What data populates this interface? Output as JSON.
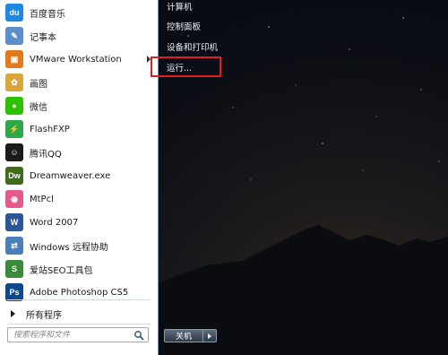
{
  "programs": [
    {
      "label": "百度音乐",
      "icon": "baidu-music-icon",
      "color": "#1e88e5",
      "glyph": "du"
    },
    {
      "label": "记事本",
      "icon": "notepad-icon",
      "color": "#5b8fc7",
      "glyph": "✎"
    },
    {
      "label": "VMware Workstation",
      "icon": "vmware-icon",
      "color": "#e07a1f",
      "glyph": "▣"
    },
    {
      "label": "画图",
      "icon": "paint-icon",
      "color": "#d9a63b",
      "glyph": "✿"
    },
    {
      "label": "微信",
      "icon": "wechat-icon",
      "color": "#2dc100",
      "glyph": "●"
    },
    {
      "label": "FlashFXP",
      "icon": "flashfxp-icon",
      "color": "#2ea84a",
      "glyph": "⚡"
    },
    {
      "label": "腾讯QQ",
      "icon": "qq-icon",
      "color": "#1a1a1a",
      "glyph": "☺"
    },
    {
      "label": "Dreamweaver.exe",
      "icon": "dreamweaver-icon",
      "color": "#3f6b1a",
      "glyph": "Dw"
    },
    {
      "label": "MtPcl",
      "icon": "mtpcl-icon",
      "color": "#e45a8a",
      "glyph": "◉"
    },
    {
      "label": "Word 2007",
      "icon": "word-icon",
      "color": "#2b5797",
      "glyph": "W"
    },
    {
      "label": "Windows 远程协助",
      "icon": "remote-assistance-icon",
      "color": "#4a7fb8",
      "glyph": "⇄"
    },
    {
      "label": "爱站SEO工具包",
      "icon": "aizhan-seo-icon",
      "color": "#3a8a3a",
      "glyph": "S"
    },
    {
      "label": "Adobe Photoshop CS5",
      "icon": "photoshop-icon",
      "color": "#0b4a8a",
      "glyph": "Ps"
    }
  ],
  "all_programs_label": "所有程序",
  "search": {
    "placeholder": "搜索程序和文件"
  },
  "right_panel": {
    "computer": "计算机",
    "control_panel": "控制面板",
    "devices_printers": "设备和打印机",
    "run": "运行..."
  },
  "shutdown": {
    "label": "关机"
  },
  "colors": {
    "highlight_border": "#e02020",
    "left_panel_bg": "#ffffff",
    "right_text": "#e8eef6"
  }
}
